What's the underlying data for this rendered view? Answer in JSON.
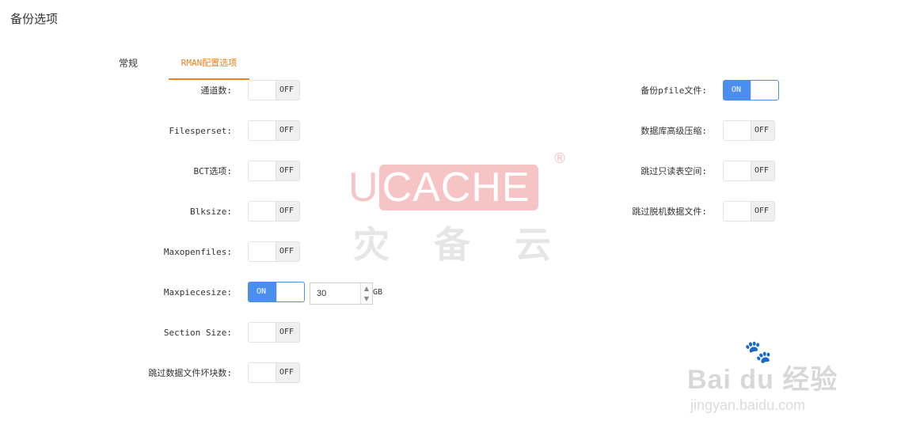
{
  "page": {
    "title": "备份选项"
  },
  "tabs": [
    {
      "label": "常规",
      "active": false
    },
    {
      "label": "RMAN配置选项",
      "active": true
    }
  ],
  "left_options": [
    {
      "label": "通道数:",
      "state": "OFF"
    },
    {
      "label": "Filesperset:",
      "state": "OFF"
    },
    {
      "label": "BCT选项:",
      "state": "OFF"
    },
    {
      "label": "Blksize:",
      "state": "OFF"
    },
    {
      "label": "Maxopenfiles:",
      "state": "OFF"
    },
    {
      "label": "Maxpiecesize:",
      "state": "ON"
    },
    {
      "label": "Section Size:",
      "state": "OFF"
    },
    {
      "label": "跳过数据文件坏块数:",
      "state": "OFF"
    }
  ],
  "maxpiecesize_input": {
    "value": "30",
    "unit": "GB"
  },
  "right_options": [
    {
      "label": "备份pfile文件:",
      "state": "ON"
    },
    {
      "label": "数据库高级压缩:",
      "state": "OFF"
    },
    {
      "label": "跳过只读表空间:",
      "state": "OFF"
    },
    {
      "label": "跳过脱机数据文件:",
      "state": "OFF"
    }
  ],
  "watermarks": {
    "ucache_u": "U",
    "ucache_rest": "CACHE",
    "registered": "®",
    "ucache_zh": "灾备云",
    "baidu": "Bai du 经验",
    "jingyan": "jingyan.baidu.com"
  },
  "colors": {
    "accent_orange": "#e8821e",
    "toggle_on_blue": "#4a8ef0"
  },
  "icons": {
    "spin_up": "▲",
    "spin_down": "▼",
    "paw": "🐾"
  }
}
